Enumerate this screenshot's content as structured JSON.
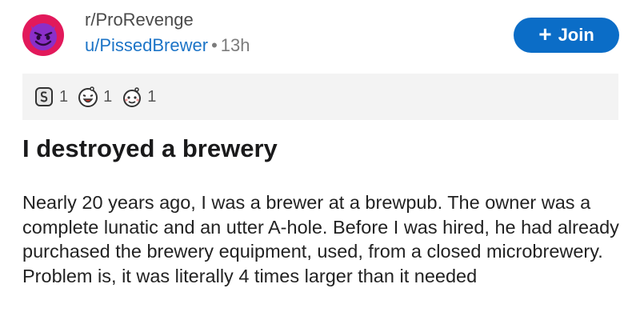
{
  "post": {
    "subreddit": "r/ProRevenge",
    "username": "u/PissedBrewer",
    "separator": "•",
    "time": "13h",
    "join_label": "Join",
    "title": "I destroyed a brewery",
    "body": "Nearly 20 years ago, I was a brewer at a brewpub. The owner was a complete lunatic and an utter A-hole. Before I was hired, he had already purchased the brewery equipment, used, from a closed microbrewery. Problem is, it was literally 4 times larger than it needed"
  },
  "awards": [
    {
      "icon": "silver-award-icon",
      "count": "1"
    },
    {
      "icon": "laughing-award-icon",
      "count": "1"
    },
    {
      "icon": "wholesome-award-icon",
      "count": "1"
    }
  ],
  "colors": {
    "join_button": "#0b6dc7",
    "username": "#1c74c7",
    "awards_bg": "#f3f3f3",
    "avatar": "#e2195b"
  }
}
